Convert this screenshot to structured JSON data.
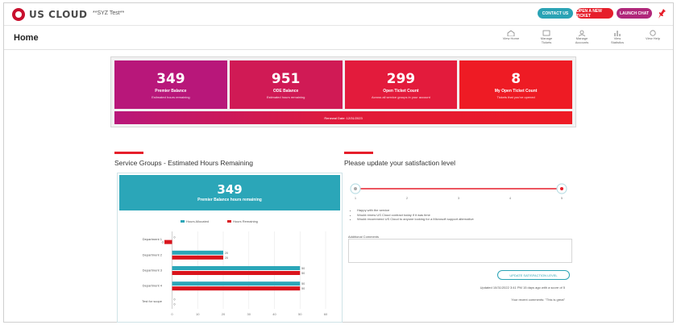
{
  "app": {
    "logo_text": "US CLOUD",
    "tenant_label": "**SYZ Test**"
  },
  "top_buttons": [
    "CONTACT US",
    "OPEN A NEW TICKET",
    "LAUNCH CHAT"
  ],
  "colors": {
    "brand_red": "#e61e2a",
    "teal": "#2aa3b5",
    "purple": "#b0277a",
    "magenta": "#b8177a"
  },
  "page": {
    "title": "Home"
  },
  "nav": [
    {
      "icon": "view-home-icon",
      "label": "View Home"
    },
    {
      "icon": "manage-tickets-icon",
      "label": "Manage Tickets"
    },
    {
      "icon": "manage-accounts-icon",
      "label": "Manage Accounts"
    },
    {
      "icon": "view-statistics-icon",
      "label": "View Statistics"
    },
    {
      "icon": "view-help-icon",
      "label": "View Help"
    }
  ],
  "stats": [
    {
      "value": "349",
      "label": "Premier Balance",
      "sub": "Estimated hours remaining"
    },
    {
      "value": "951",
      "label": "ODE Balance",
      "sub": "Estimated hours remaining"
    },
    {
      "value": "299",
      "label": "Open Ticket Count",
      "sub": "Across all service groups in your account"
    },
    {
      "value": "8",
      "label": "My Open Ticket Count",
      "sub": "Tickets that you've opened"
    }
  ],
  "renewal": "Renewal Date: 12/31/2023",
  "service_groups": {
    "title": "Service Groups - Estimated Hours Remaining",
    "banner_value": "349",
    "banner_label": "Premier Balance hours remaining"
  },
  "chart_data": {
    "type": "bar",
    "orientation": "horizontal",
    "categories": [
      "Department 1",
      "Department 2",
      "Department 3",
      "Department 4",
      "Test for scope"
    ],
    "series": [
      {
        "name": "Hours Allocated",
        "color": "#2ba6b8",
        "values": [
          0,
          20,
          50,
          50,
          0
        ]
      },
      {
        "name": "Hours Remaining",
        "color": "#d9141c",
        "values": [
          -3,
          20,
          50,
          50,
          0
        ]
      }
    ],
    "data_labels": [
      "0",
      "-3",
      "20",
      "20",
      "50",
      "50",
      "50",
      "50",
      "0",
      "0"
    ],
    "x_ticks": [
      "0",
      "10",
      "20",
      "30",
      "40",
      "50",
      "60"
    ],
    "xlim": [
      -3,
      60
    ],
    "legend_position": "top"
  },
  "satisfaction": {
    "title": "Please update your satisfaction level",
    "scale": [
      "1",
      "2",
      "3",
      "4",
      "5"
    ],
    "selected": 5,
    "bullets": [
      "Happy with the service",
      "Would renew US Cloud contract today if it was time",
      "Would recommend US Cloud to anyone looking for a Microsoft support alternative"
    ],
    "comment_label": "Additional Comments",
    "comment_value": "",
    "submit_label": "UPDATE SATISFACTION LEVEL",
    "updated_text": "Updated 10/31/2022 3:41 PM 15 days ago with a score of 5",
    "recent_text": "Your recent comments: \"This is great\""
  }
}
